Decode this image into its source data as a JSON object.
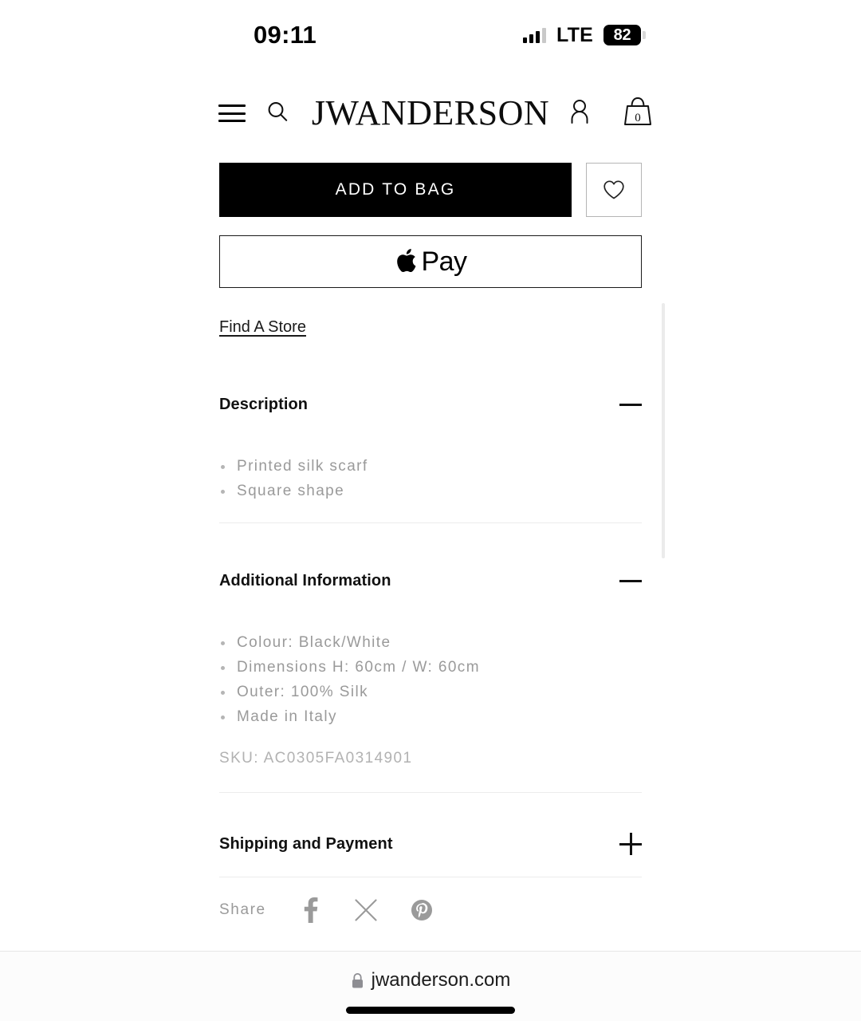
{
  "status_bar": {
    "time": "09:11",
    "network": "LTE",
    "battery_level": "82",
    "signal_icon": "signal-bars-icon"
  },
  "header": {
    "menu_icon": "hamburger-menu-icon",
    "search_icon": "search-icon",
    "logo_main": "JW",
    "logo_text": "ANDERSON",
    "account_icon": "account-person-icon",
    "bag_icon": "shopping-bag-icon",
    "bag_count": "0"
  },
  "actions": {
    "add_to_bag_label": "ADD TO BAG",
    "wishlist_icon": "heart-outline-icon",
    "apple_pay_icon": "apple-logo-icon",
    "apple_pay_label": "Pay",
    "find_store_label": "Find A Store"
  },
  "accordions": [
    {
      "title": "Description",
      "state": "expanded",
      "toggle_icon": "minus-icon",
      "bullets": [
        "Printed silk scarf",
        "Square shape"
      ]
    },
    {
      "title": "Additional Information",
      "state": "expanded",
      "toggle_icon": "minus-icon",
      "bullets": [
        "Colour: Black/White",
        "Dimensions H: 60cm / W: 60cm",
        "Outer: 100% Silk",
        "Made in Italy"
      ],
      "sku": "SKU: AC0305FA0314901"
    },
    {
      "title": "Shipping and Payment",
      "state": "collapsed",
      "toggle_icon": "plus-icon"
    }
  ],
  "share": {
    "label": "Share",
    "networks": [
      {
        "name": "facebook-icon"
      },
      {
        "name": "x-twitter-icon"
      },
      {
        "name": "pinterest-icon"
      }
    ]
  },
  "browser": {
    "lock_icon": "lock-icon",
    "url": "jwanderson.com"
  },
  "colors": {
    "accent": "#000000",
    "muted_text": "#9a9a9a",
    "divider": "#ececec",
    "border": "#b5b5b5"
  }
}
